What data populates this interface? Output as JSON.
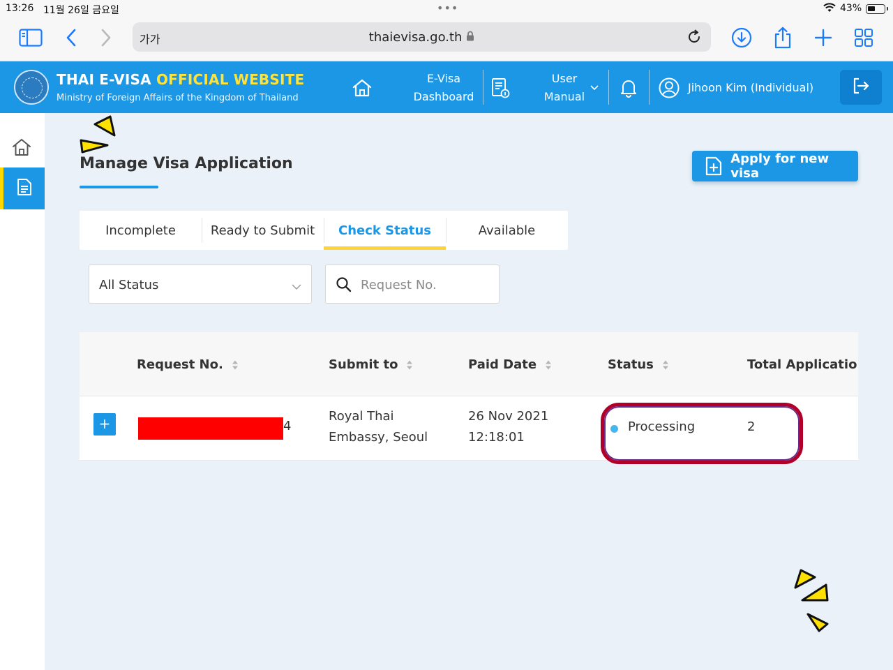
{
  "device": {
    "time": "13:26",
    "date": "11월 26일 금요일",
    "battery": "43%"
  },
  "browser": {
    "text_size_button": "가가",
    "url": "thaievisa.go.th",
    "icons": [
      "sidebar-icon",
      "back-icon",
      "forward-icon",
      "lock-icon",
      "reload-icon",
      "download-icon",
      "share-icon",
      "plus-icon",
      "tabs-grid-icon"
    ]
  },
  "header": {
    "brand_white": "THAI E-VISA ",
    "brand_yellow": "OFFICIAL WEBSITE",
    "ministry": "Ministry of Foreign Affairs of the Kingdom of Thailand",
    "dashboard_line1": "E-Visa",
    "dashboard_line2": "Dashboard",
    "manual_line1": "User",
    "manual_line2": "Manual",
    "user": "Jihoon Kim (Individual)",
    "colors": {
      "bar": "#1b97e6",
      "accent": "#ffe339"
    }
  },
  "page": {
    "title": "Manage Visa Application",
    "apply_button": "Apply for new visa",
    "tabs": [
      "Incomplete",
      "Ready to Submit",
      "Check Status",
      "Available"
    ],
    "active_tab": "Check Status",
    "filter": {
      "selected": "All Status",
      "search_placeholder": "Request No."
    }
  },
  "table": {
    "columns": [
      "Request No.",
      "Submit to",
      "Paid Date",
      "Status",
      "Total Applications"
    ],
    "rows": [
      {
        "expand": "+",
        "request_tail": "4",
        "submit_line1": "Royal Thai",
        "submit_line2": "Embassy, Seoul",
        "paid_line1": "26 Nov 2021",
        "paid_line2": "12:18:01",
        "status": "Processing",
        "total": "2"
      }
    ]
  }
}
